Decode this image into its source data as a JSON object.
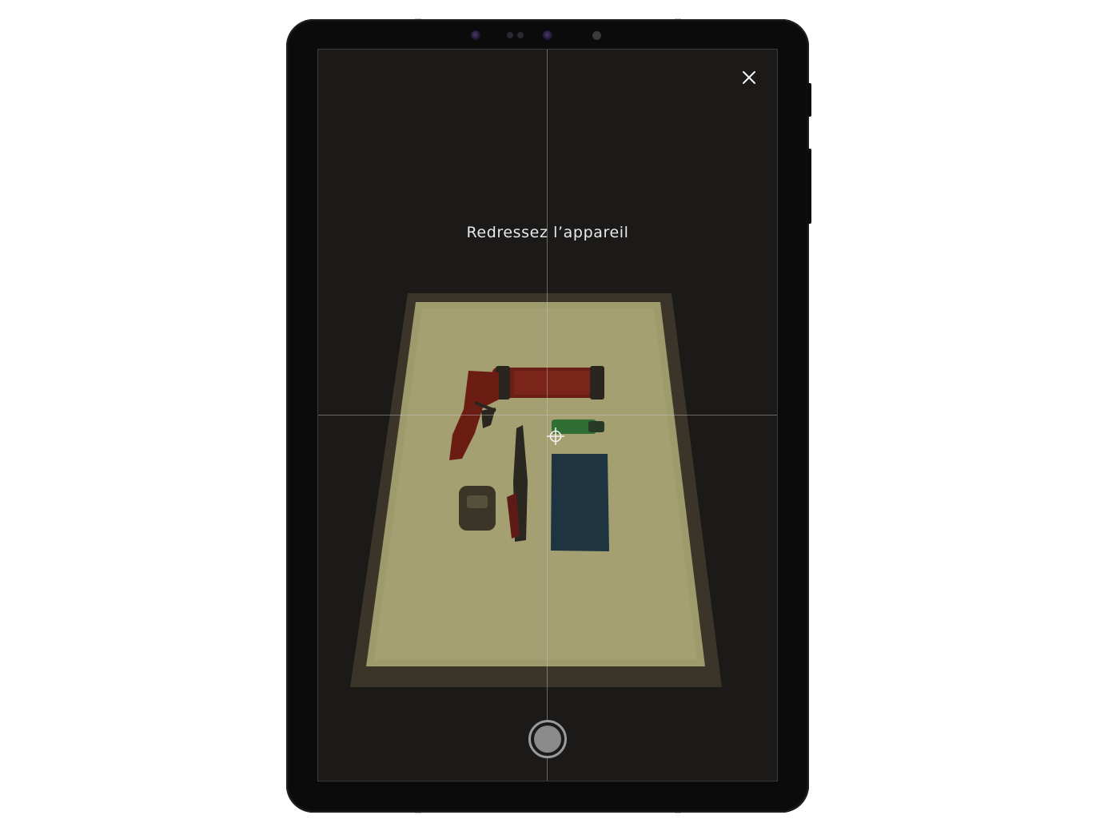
{
  "camera": {
    "instruction": "Redressez l’appareil"
  },
  "icons": {
    "close": "close-icon",
    "target": "crosshair-target-icon",
    "shutter": "shutter-button"
  },
  "colors": {
    "screen_background": "#1c1a19",
    "instruction_text": "#e9e9e9",
    "guide_lines": "#c8c8c8",
    "device_body": "#0b0b0b"
  }
}
